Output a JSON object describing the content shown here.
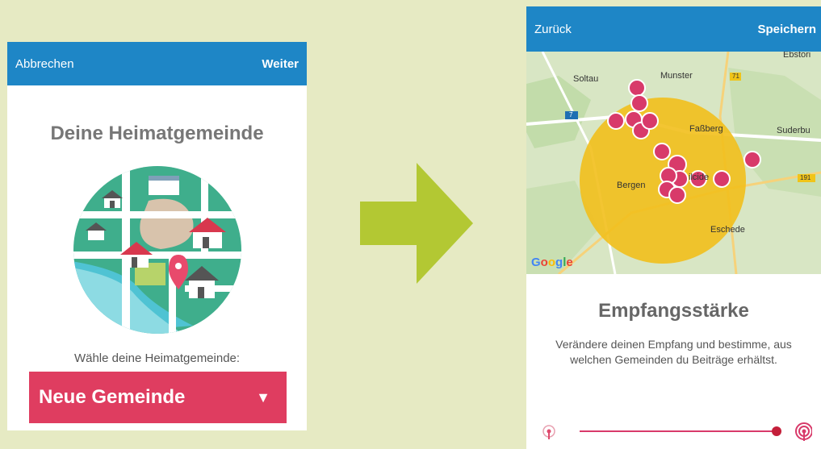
{
  "left": {
    "cancel_label": "Abbrechen",
    "next_label": "Weiter",
    "title": "Deine Heimatgemeinde",
    "prompt": "Wähle deine Heimatgemeinde:",
    "dropdown_value": "Neue Gemeinde",
    "dropdown_caret": "▼"
  },
  "right": {
    "back_label": "Zurück",
    "save_label": "Speichern",
    "map_labels": [
      "Ebstorf",
      "Soltau",
      "Munster",
      "71",
      "7",
      "Faßberg",
      "Suderburg",
      "Bergen",
      "Celle",
      "191",
      "Eschede"
    ],
    "map_label_visible": {
      "ebstorf": "Ebstori",
      "soltau": "Soltau",
      "munster": "Munster",
      "r71": "71",
      "r7": "7",
      "fassberg": "Faßberg",
      "suderburg": "Suderbu",
      "bergen": "Bergen",
      "celle": "ilcide",
      "r191": "191",
      "eschede": "Eschede"
    },
    "google_label": "Google",
    "title": "Empfangsstärke",
    "description": "Verändere deinen Empfang und bestimme, aus welchen Gemeinden du Beiträge erhältst.",
    "slider_level": 1.0
  },
  "colors": {
    "background": "#e6eac3",
    "bar": "#1e86c6",
    "accent": "#df3d60",
    "arrow": "#b3c833",
    "radius": "#f2bf1c"
  }
}
